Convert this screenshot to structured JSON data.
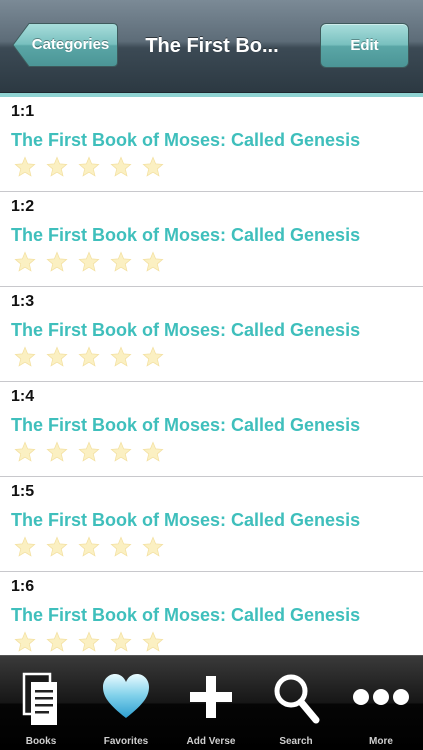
{
  "navbar": {
    "back_label": "Categories",
    "title": "The First Bo...",
    "edit_label": "Edit",
    "accent_color": "#8fd3d2"
  },
  "verses": [
    {
      "ref": "1:1",
      "title": "The First Book of Moses:  Called Genesis",
      "rating": 0,
      "max_rating": 5
    },
    {
      "ref": "1:2",
      "title": "The First Book of Moses:  Called Genesis",
      "rating": 0,
      "max_rating": 5
    },
    {
      "ref": "1:3",
      "title": "The First Book of Moses:  Called Genesis",
      "rating": 0,
      "max_rating": 5
    },
    {
      "ref": "1:4",
      "title": "The First Book of Moses:  Called Genesis",
      "rating": 0,
      "max_rating": 5
    },
    {
      "ref": "1:5",
      "title": "The First Book of Moses:  Called Genesis",
      "rating": 0,
      "max_rating": 5
    },
    {
      "ref": "1:6",
      "title": "The First Book of Moses:  Called Genesis",
      "rating": 0,
      "max_rating": 5
    }
  ],
  "tabbar": {
    "tabs": [
      {
        "label": "Books",
        "icon": "books-icon",
        "selected": true
      },
      {
        "label": "Favorites",
        "icon": "heart-icon",
        "selected": false
      },
      {
        "label": "Add Verse",
        "icon": "plus-icon",
        "selected": false
      },
      {
        "label": "Search",
        "icon": "magnifier-icon",
        "selected": false
      },
      {
        "label": "More",
        "icon": "more-dots-icon",
        "selected": false
      }
    ]
  },
  "colors": {
    "verse_title": "#3fbfbc",
    "star_empty": "#fbf0c2",
    "edit_button": "#79c0bf"
  }
}
